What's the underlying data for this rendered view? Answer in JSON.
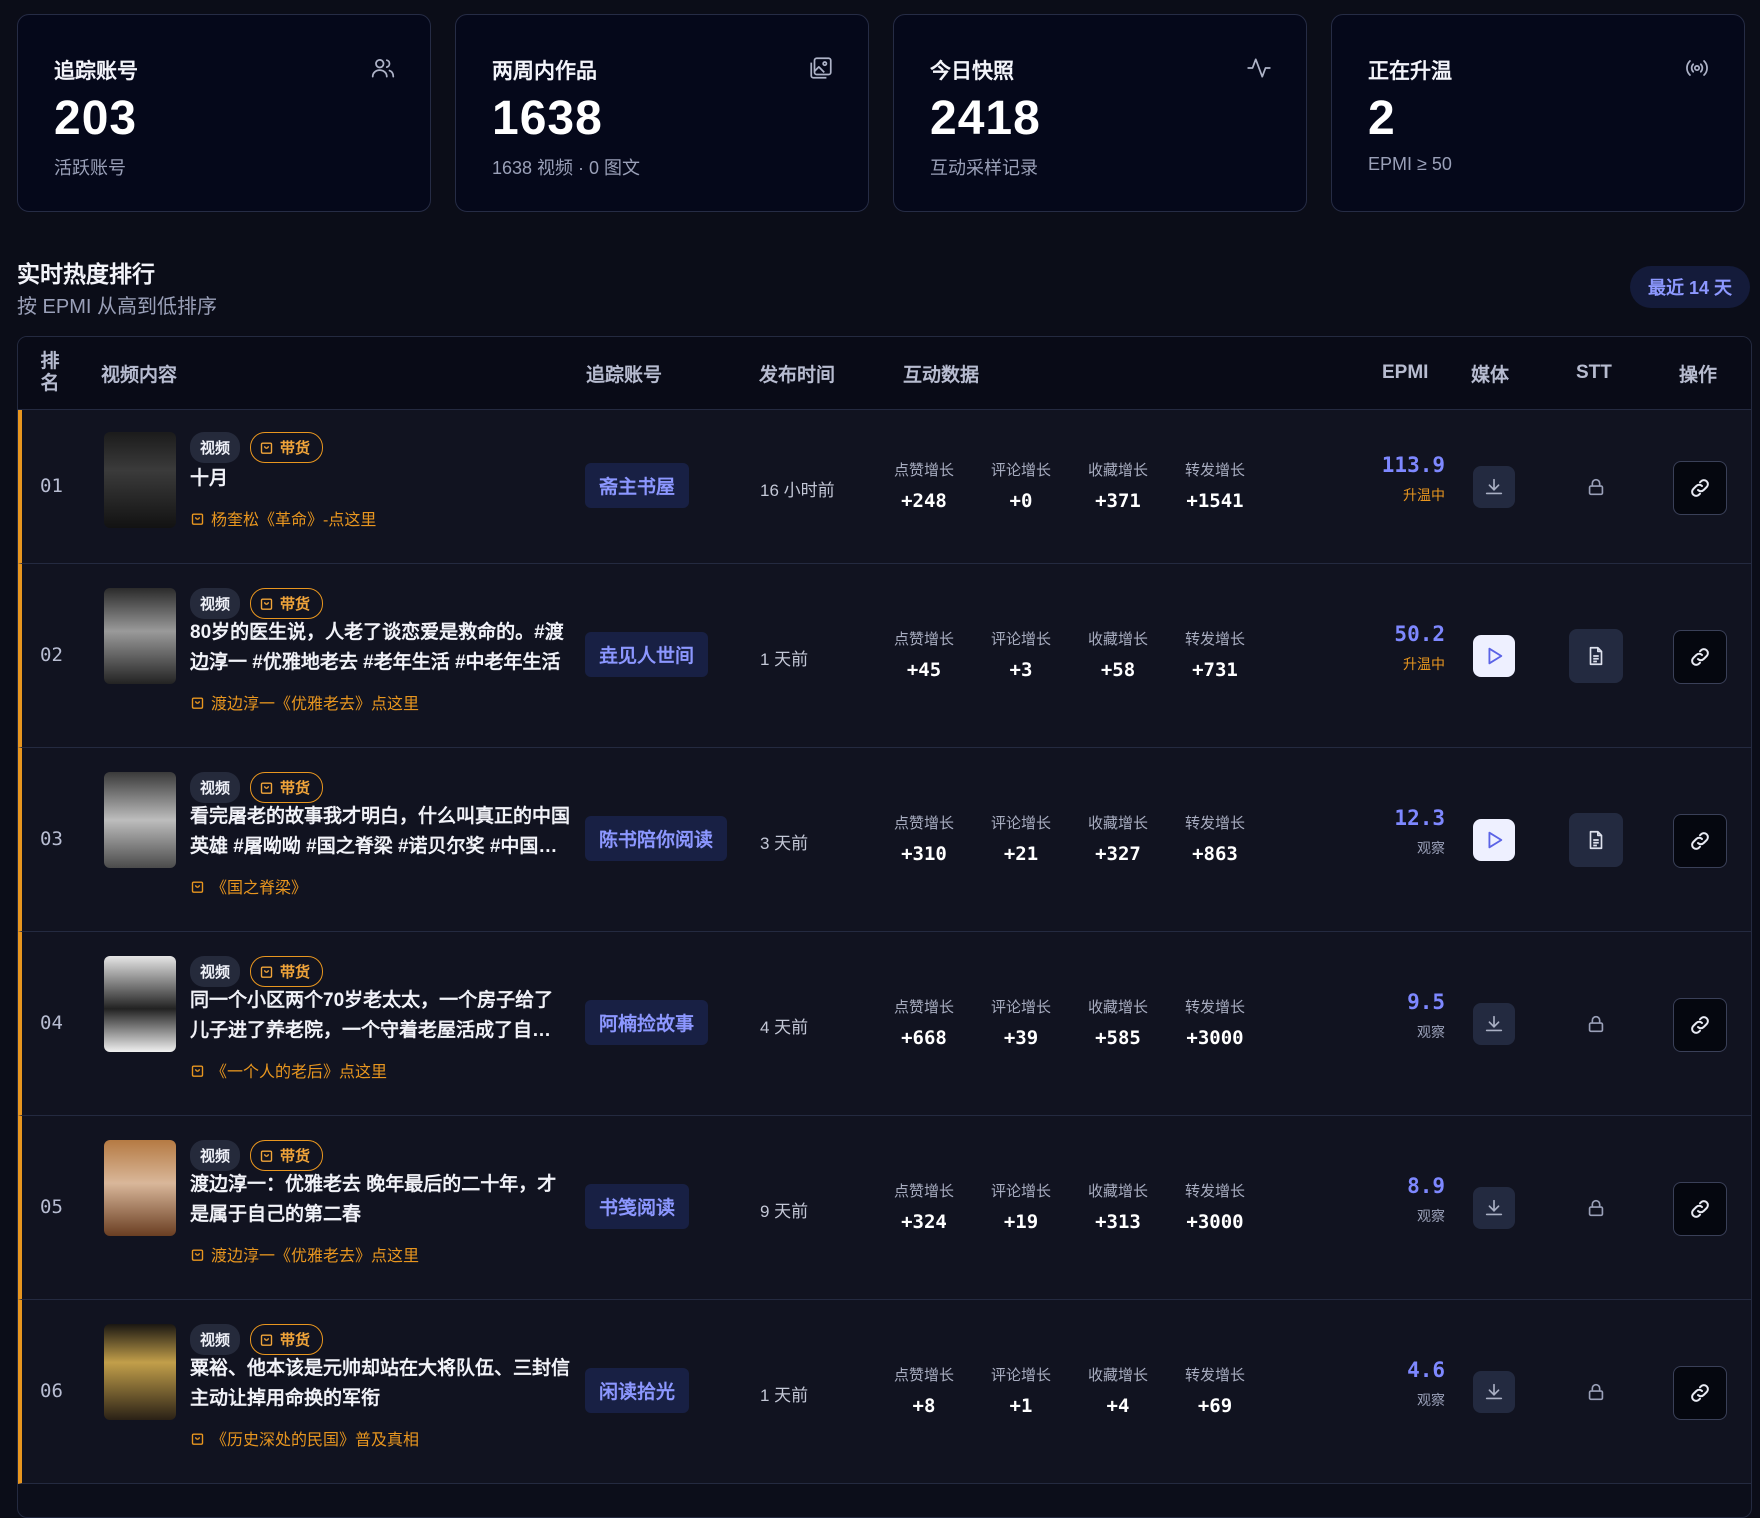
{
  "cards": [
    {
      "title": "追踪账号",
      "value": "203",
      "sub": "活跃账号",
      "icon": "users-icon"
    },
    {
      "title": "两周内作品",
      "value": "1638",
      "sub": "1638 视频 · 0 图文",
      "icon": "gallery-icon"
    },
    {
      "title": "今日快照",
      "value": "2418",
      "sub": "互动采样记录",
      "icon": "activity-icon"
    },
    {
      "title": "正在升温",
      "value": "2",
      "sub": "EPMI ≥ 50",
      "icon": "broadcast-icon"
    }
  ],
  "section": {
    "title": "实时热度排行",
    "subtitle": "按 EPMI 从高到低排序",
    "range": "最近 14 天"
  },
  "table": {
    "headers": {
      "rank_top": "排",
      "rank_bottom": "名",
      "content": "视频内容",
      "account": "追踪账号",
      "time": "发布时间",
      "interact": "互动数据",
      "epmi": "EPMI",
      "media": "媒体",
      "stt": "STT",
      "action": "操作"
    },
    "metric_labels": [
      "点赞增长",
      "评论增长",
      "收藏增长",
      "转发增长"
    ],
    "badge_video": "视频",
    "badge_goods": "带货",
    "rows": [
      {
        "rank": "01",
        "title": "十月",
        "goods": "杨奎松《革命》-点这里",
        "account": "斋主书屋",
        "time": "16 小时前",
        "likes": "+248",
        "comments": "+0",
        "favs": "+371",
        "shares": "+1541",
        "epmi": "113.9",
        "status": "升温中",
        "media": "download",
        "stt": "lock"
      },
      {
        "rank": "02",
        "title": "80岁的医生说，人老了谈恋爱是救命的。#渡边淳一 #优雅地老去 #老年生活 #中老年生活",
        "goods": "渡边淳一《优雅老去》点这里",
        "account": "垚见人世间",
        "time": "1 天前",
        "likes": "+45",
        "comments": "+3",
        "favs": "+58",
        "shares": "+731",
        "epmi": "50.2",
        "status": "升温中",
        "media": "play",
        "stt": "doc"
      },
      {
        "rank": "03",
        "title": "看完屠老的故事我才明白，什么叫真正的中国英雄 #屠呦呦 #国之脊梁 #诺贝尔奖 #中国脊梁 #人物故事",
        "goods": "《国之脊梁》",
        "account": "陈书陪你阅读",
        "time": "3 天前",
        "likes": "+310",
        "comments": "+21",
        "favs": "+327",
        "shares": "+863",
        "epmi": "12.3",
        "status": "观察",
        "media": "play",
        "stt": "doc"
      },
      {
        "rank": "04",
        "title": "同一个小区两个70岁老太太，一个房子给了儿子进了养老院，一个守着老屋活成了自己 #养老 #人生",
        "goods": "《一个人的老后》点这里",
        "account": "阿楠捡故事",
        "time": "4 天前",
        "likes": "+668",
        "comments": "+39",
        "favs": "+585",
        "shares": "+3000",
        "epmi": "9.5",
        "status": "观察",
        "media": "download",
        "stt": "lock"
      },
      {
        "rank": "05",
        "title": "渡边淳一：优雅老去 晚年最后的二十年，才是属于自己的第二春",
        "goods": "渡边淳一《优雅老去》点这里",
        "account": "书笺阅读",
        "time": "9 天前",
        "likes": "+324",
        "comments": "+19",
        "favs": "+313",
        "shares": "+3000",
        "epmi": "8.9",
        "status": "观察",
        "media": "download",
        "stt": "lock"
      },
      {
        "rank": "06",
        "title": "粟裕、他本该是元帅却站在大将队伍、三封信主动让掉用命换的军衔",
        "goods": "《历史深处的民国》普及真相",
        "account": "闲读拾光",
        "time": "1 天前",
        "likes": "+8",
        "comments": "+1",
        "favs": "+4",
        "shares": "+69",
        "epmi": "4.6",
        "status": "观察",
        "media": "download",
        "stt": "lock"
      }
    ]
  }
}
